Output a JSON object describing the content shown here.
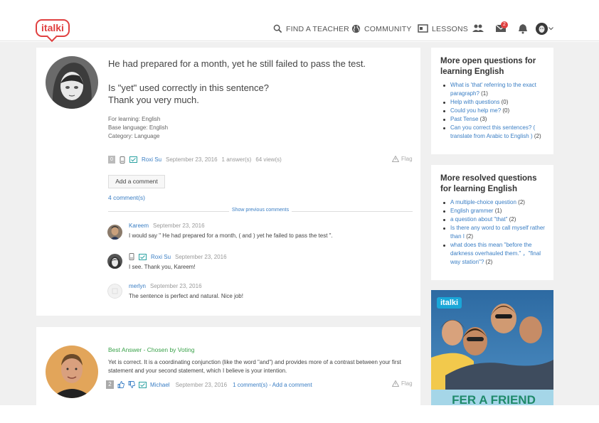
{
  "header": {
    "logo_text": "italki",
    "nav": {
      "find_teacher": "FIND A TEACHER",
      "community": "COMMUNITY",
      "lessons": "LESSONS"
    },
    "messages_badge": "2",
    "icons": [
      "search-icon",
      "globe-icon",
      "lessons-icon",
      "people-icon",
      "mail-icon",
      "bell-icon",
      "avatar",
      "chevron-down-icon"
    ]
  },
  "question": {
    "title": "He had prepared for a month, yet he still failed to pass the test.",
    "body_line1": "Is \"yet\" used correctly in this sentence?",
    "body_line2": "Thank you very much.",
    "for_learning": "For learning: English",
    "base_language": "Base language: English",
    "category": "Category: Language",
    "score": "0",
    "author": "Roxi Su",
    "date": "September 23, 2016",
    "answers": "1 answer(s)",
    "views": "64 view(s)",
    "flag": "Flag",
    "add_comment": "Add a comment",
    "comment_count": "4 comment(s)",
    "show_previous": "Show previous comments"
  },
  "comments": [
    {
      "author": "Kareem",
      "date": "September 23, 2016",
      "text": "I would say \" He had prepared for a month, ( and ) yet he failed to pass the test \"."
    },
    {
      "author": "Roxi Su",
      "date": "September 23, 2016",
      "text": "I see. Thank you, Kareem!"
    },
    {
      "author": "merlyn",
      "date": "September 23, 2016",
      "text": "The sentence is perfect and natural. Nice job!"
    }
  ],
  "answer": {
    "label": "Best Answer - Chosen by Voting",
    "text": "Yet is correct. It is a coordinating conjunction (like the word \"and\") and provides more of a contrast between your first statement and your second statement, which I believe is your intention.",
    "score": "2",
    "author": "Michael",
    "date": "September 23, 2016",
    "comments_link": "1 comment(s)",
    "separator": " - ",
    "add_comment": "Add a comment",
    "flag": "Flag"
  },
  "sidebar": {
    "open": {
      "title": "More open questions for learning English",
      "items": [
        {
          "link": "What is 'that' referring to the exact paragraph?",
          "count": " (1)"
        },
        {
          "link": "Help with questions",
          "count": " (0)"
        },
        {
          "link": "Could you help me?",
          "count": " (0)"
        },
        {
          "link": "Past Tense",
          "count": " (3)"
        },
        {
          "link": "Can you correct this sentences? ( translate from Arabic to English )",
          "count": " (2)"
        }
      ]
    },
    "resolved": {
      "title": "More resolved questions for learning English",
      "items": [
        {
          "link": "A multiple-choice question",
          "count": " (2)"
        },
        {
          "link": "English grammer",
          "count": " (1)"
        },
        {
          "link": "a question about \"that\"",
          "count": " (2)"
        },
        {
          "link": "Is there any word to call myself rather than I",
          "count": " (2)"
        },
        {
          "link": "what does this mean \"before the darkness overhauled them.\" ，\"final way station\"?",
          "count": " (2)"
        }
      ]
    },
    "ad": {
      "logo": "italki",
      "text": "FER A FRIEND"
    }
  },
  "colors": {
    "brand_red": "#e04040",
    "link_blue": "#3a7ec4",
    "best_green": "#3aa24a",
    "page_gray": "#f0f0f0"
  }
}
